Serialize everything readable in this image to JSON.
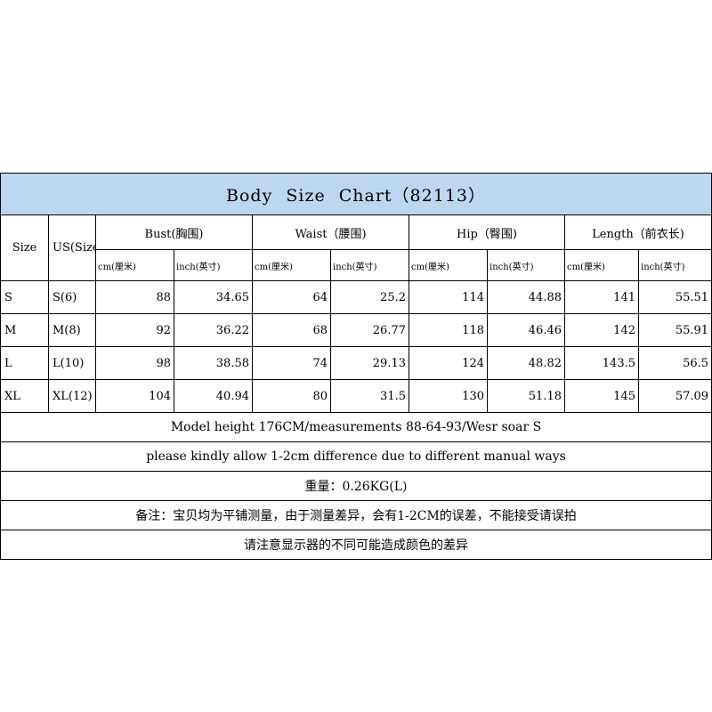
{
  "title": "Body  Size  Chart（82113）",
  "headers": {
    "size": "Size",
    "us_size": "US(Size)",
    "groups": [
      "Bust(胸围)",
      "Waist（腰围)",
      "Hip（臀围)",
      "Length（前衣长)"
    ],
    "units": [
      "cm(厘米)",
      "inch(英寸)",
      "cm(厘米)",
      "inch(英寸)",
      "cm(厘米)",
      "inch(英寸)",
      "cm(厘米)",
      "inch(英寸)"
    ]
  },
  "rows": [
    {
      "size": "S",
      "us": "S(6)",
      "values": [
        "88",
        "34.65",
        "64",
        "25.2",
        "114",
        "44.88",
        "141",
        "55.51"
      ]
    },
    {
      "size": "M",
      "us": "M(8)",
      "values": [
        "92",
        "36.22",
        "68",
        "26.77",
        "118",
        "46.46",
        "142",
        "55.91"
      ]
    },
    {
      "size": "L",
      "us": "L(10)",
      "values": [
        "98",
        "38.58",
        "74",
        "29.13",
        "124",
        "48.82",
        "143.5",
        "56.5"
      ]
    },
    {
      "size": "XL",
      "us": "XL(12)",
      "values": [
        "104",
        "40.94",
        "80",
        "31.5",
        "130",
        "51.18",
        "145",
        "57.09"
      ]
    }
  ],
  "notes": [
    "Model height 176CM/measurements 88-64-93/Wesr soar S",
    "please kindly allow 1-2cm difference due to different manual ways",
    "重量：0.26KG(L)",
    "备注：宝贝均为平铺测量，由于测量差异，会有1-2CM的误差，不能接受请误拍",
    "请注意显示器的不同可能造成颜色的差异"
  ]
}
